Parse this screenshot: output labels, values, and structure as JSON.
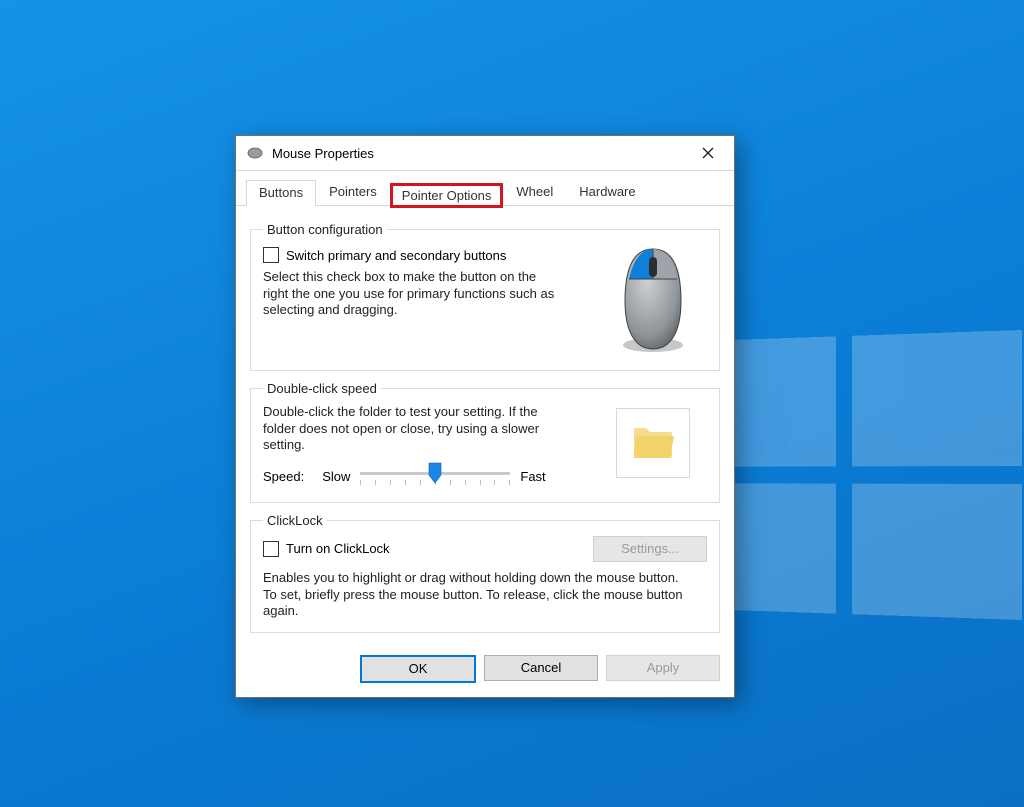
{
  "dialog": {
    "title": "Mouse Properties",
    "tabs": {
      "buttons": "Buttons",
      "pointers": "Pointers",
      "pointer_options": "Pointer Options",
      "wheel": "Wheel",
      "hardware": "Hardware"
    },
    "button_config": {
      "legend": "Button configuration",
      "switch_label": "Switch primary and secondary buttons",
      "switch_checked": false,
      "description": "Select this check box to make the button on the right the one you use for primary functions such as selecting and dragging."
    },
    "double_click": {
      "legend": "Double-click speed",
      "description": "Double-click the folder to test your setting. If the folder does not open or close, try using a slower setting.",
      "speed_label": "Speed:",
      "slow_label": "Slow",
      "fast_label": "Fast",
      "value": 5,
      "min": 0,
      "max": 10
    },
    "clicklock": {
      "legend": "ClickLock",
      "turn_on_label": "Turn on ClickLock",
      "turn_on_checked": false,
      "settings_label": "Settings...",
      "description": "Enables you to highlight or drag without holding down the mouse button. To set, briefly press the mouse button. To release, click the mouse button again."
    },
    "buttons_row": {
      "ok": "OK",
      "cancel": "Cancel",
      "apply": "Apply"
    }
  }
}
